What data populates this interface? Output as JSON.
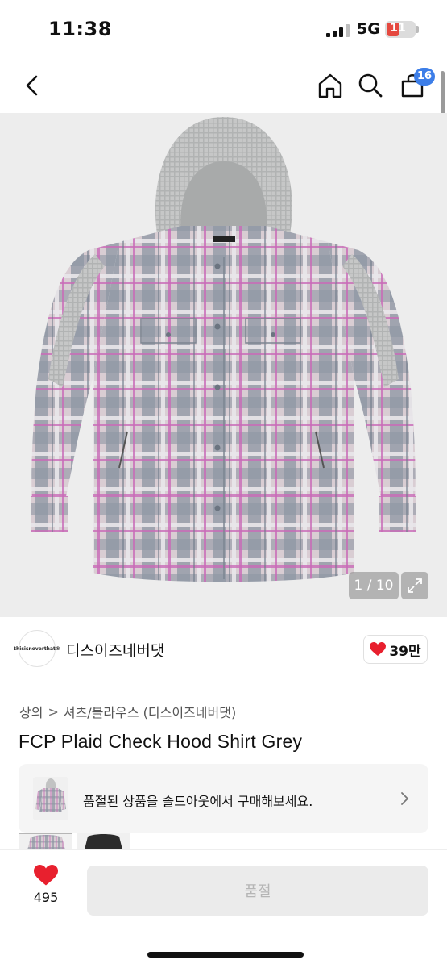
{
  "status": {
    "time": "11:38",
    "network": "5G",
    "battery": "11",
    "battery_level": 0.11
  },
  "nav": {
    "cart_count": "16",
    "icons": [
      "back-chevron-icon",
      "home-icon",
      "search-icon",
      "cart-icon"
    ]
  },
  "gallery": {
    "counter": "1 / 10",
    "expand_icon": "expand-arrows-icon"
  },
  "brand": {
    "logo_text": "thisisneverthat®",
    "name": "디스이즈네버댓",
    "likes": "39만"
  },
  "breadcrumb": {
    "category": "상의",
    "separator": ">",
    "subcategory": "셔츠/블라우스 (디스이즈네버댓)"
  },
  "product": {
    "title": "FCP Plaid Check Hood Shirt Grey"
  },
  "soldout_banner": {
    "text": "품절된 상품을 솔드아웃에서 구매해보세요."
  },
  "bottom_bar": {
    "wish_count": "495",
    "buy_label": "품절"
  },
  "colors": {
    "accent_badge": "#3d7ee8",
    "heart": "#e8202e",
    "disabled_button_bg": "#ebebeb",
    "disabled_button_text": "#b5b5b5"
  }
}
